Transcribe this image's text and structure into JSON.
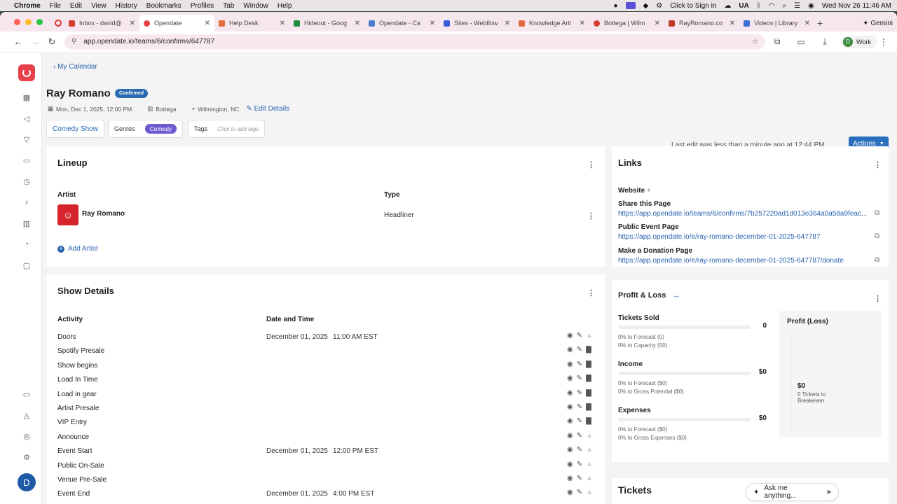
{
  "menubar": {
    "app": "Chrome",
    "items": [
      "File",
      "Edit",
      "View",
      "History",
      "Bookmarks",
      "Profiles",
      "Tab",
      "Window",
      "Help"
    ],
    "sign_in": "Click to Sign in",
    "input_source": "UA",
    "clock": "Wed Nov 26  11:46 AM"
  },
  "tabs": [
    {
      "label": "Inbox - david@",
      "color": "#d33b2f"
    },
    {
      "label": "Opendate",
      "color": "#e8404a"
    },
    {
      "label": "Help Desk",
      "color": "#e06b3c"
    },
    {
      "label": "Hideout - Goog",
      "color": "#1e8e3e"
    },
    {
      "label": "Opendate - Ca",
      "color": "#4a7bd0"
    },
    {
      "label": "Sites - Webflow",
      "color": "#3b5bdb"
    },
    {
      "label": "Knowledge Arti",
      "color": "#e06b3c"
    },
    {
      "label": "Bottega | Wilm",
      "color": "#d33b2f"
    },
    {
      "label": "RayRomano.co",
      "color": "#c0392b"
    },
    {
      "label": "Videos | Library",
      "color": "#3b6fd6"
    }
  ],
  "gemini": "Gemini",
  "url": "app.opendate.io/teams/6/confirms/647787",
  "profile": {
    "initial": "D",
    "label": "Work"
  },
  "sidebar_avatar": "D",
  "page": {
    "back": "My Calendar",
    "title": "Ray Romano",
    "status": "Confirmed",
    "date": "Mon, Dec 1, 2025, 12:00 PM",
    "venue": "Bottega",
    "location": "Wilmington, NC",
    "edit": "Edit Details",
    "event_type": "Comedy Show",
    "genres_label": "Genres",
    "genre": "Comedy",
    "tags_label": "Tags",
    "tags_placeholder": "Click to add tags",
    "last_edit": "Last edit was less than a minute ago at 12:44 PM",
    "actions": "Actions"
  },
  "lineup": {
    "title": "Lineup",
    "col_artist": "Artist",
    "col_type": "Type",
    "artist": "Ray Romano",
    "type": "Headliner",
    "add": "Add Artist"
  },
  "show_details": {
    "title": "Show Details",
    "col_activity": "Activity",
    "col_datetime": "Date and Time",
    "rows": [
      {
        "activity": "Doors",
        "date": "December 01, 2025",
        "time": "11:00 AM EST",
        "locked": true
      },
      {
        "activity": "Spotify Presale",
        "date": "",
        "time": "",
        "locked": false
      },
      {
        "activity": "Show begins",
        "date": "",
        "time": "",
        "locked": false
      },
      {
        "activity": "Load In Time",
        "date": "",
        "time": "",
        "locked": false
      },
      {
        "activity": "Load in gear",
        "date": "",
        "time": "",
        "locked": false
      },
      {
        "activity": "Artist Presale",
        "date": "",
        "time": "",
        "locked": false
      },
      {
        "activity": "VIP Entry",
        "date": "",
        "time": "",
        "locked": false
      },
      {
        "activity": "Announce",
        "date": "",
        "time": "",
        "locked": true
      },
      {
        "activity": "Event Start",
        "date": "December 01, 2025",
        "time": "12:00 PM EST",
        "locked": true
      },
      {
        "activity": "Public On-Sale",
        "date": "",
        "time": "",
        "locked": true
      },
      {
        "activity": "Venue Pre-Sale",
        "date": "",
        "time": "",
        "locked": true
      },
      {
        "activity": "Event End",
        "date": "December 01, 2025",
        "time": "4:00 PM EST",
        "locked": true
      }
    ]
  },
  "links": {
    "title": "Links",
    "website": "Website",
    "share_label": "Share this Page",
    "share_url": "https://app.opendate.io/teams/6/confirms/7b257220ad1d013e364a0a58a9feac...",
    "public_label": "Public Event Page",
    "public_url": "https://app.opendate.io/e/ray-romano-december-01-2025-647787",
    "donation_label": "Make a Donation Page",
    "donation_url": "https://app.opendate.io/e/ray-romano-december-01-2025-647787/donate"
  },
  "pl": {
    "title": "Profit & Loss",
    "tickets_label": "Tickets Sold",
    "tickets_value": "0",
    "tickets_sub1": "0% to Forecast (0)",
    "tickets_sub2": "0% to Capacity (50)",
    "income_label": "Income",
    "income_value": "$0",
    "income_sub1": "0% to Forecast ($0)",
    "income_sub2": "0% to Gross Potential ($0)",
    "expenses_label": "Expenses",
    "expenses_value": "$0",
    "expenses_sub1": "0% to Forecast ($0)",
    "expenses_sub2": "0% to Gross Expenses ($0)",
    "profit_title": "Profit (Loss)",
    "profit_value": "$0",
    "profit_sub": "0 Tickets to Breakeven",
    "progress": 0
  },
  "tickets_title": "Tickets",
  "ask": "Ask me anything..."
}
